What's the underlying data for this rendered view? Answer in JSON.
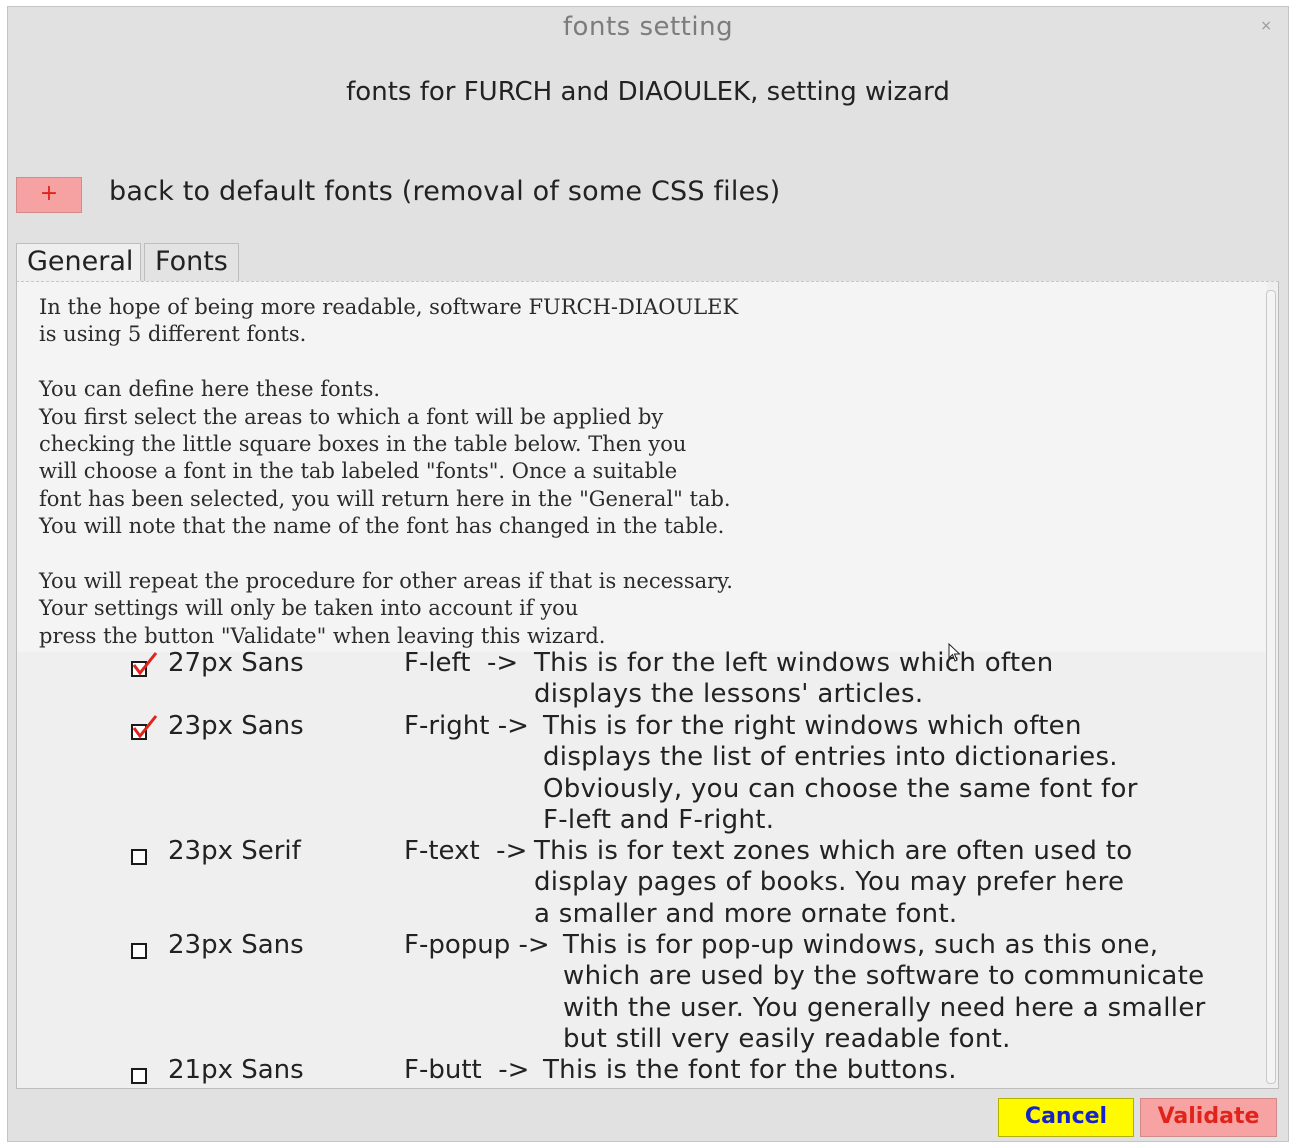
{
  "window": {
    "title": "fonts setting",
    "close_glyph": "×",
    "subtitle": "fonts for FURCH and DIAOULEK, setting wizard"
  },
  "reset": {
    "button_label": "+",
    "label": "back to default fonts (removal of some CSS files)"
  },
  "tabs": [
    {
      "label": "General",
      "active": true
    },
    {
      "label": "Fonts",
      "active": false
    }
  ],
  "intro_text": "In the hope of being more readable, software FURCH-DIAOULEK\nis using 5 different fonts.\n\nYou can define here these fonts.\nYou first select the areas to which a font will be applied by\nchecking the little square boxes in the table below. Then you\nwill choose a font in the tab labeled \"fonts\". Once a suitable\nfont has been selected, you will return here in the \"General\" tab.\nYou will note that the name of the font has changed in the table.\n\nYou will repeat the procedure for other areas if that is necessary.\nYour settings will only be taken into account if you\npress the button \"Validate\" when leaving this wizard.",
  "font_rows": [
    {
      "checked": true,
      "font": "27px Sans",
      "code": "F-left  ->",
      "description": "This is for the left windows which often\ndisplays the lessons' articles."
    },
    {
      "checked": true,
      "font": "23px Sans",
      "code": "F-right ->",
      "description": "This is for the right windows which often\ndisplays the list of entries into dictionaries.\nObviously, you can choose the same font for\nF-left and F-right."
    },
    {
      "checked": false,
      "font": "23px Serif",
      "code": "F-text  ->",
      "description": "This is for text zones which are often used to\ndisplay pages of books. You may prefer here\na smaller and more ornate font."
    },
    {
      "checked": false,
      "font": "23px Sans",
      "code": "F-popup ->",
      "description": "This is for pop-up windows, such as this one,\nwhich are used by the software to communicate\nwith the user. You generally need here a smaller\nbut still very easily readable font."
    },
    {
      "checked": false,
      "font": "21px Sans",
      "code": "F-butt  ->",
      "description": "This is the font for the buttons."
    }
  ],
  "buttons": {
    "cancel": "Cancel",
    "validate": "Validate"
  },
  "colors": {
    "check_red": "#e0241c",
    "cancel_bg": "#fffa00",
    "cancel_text": "#1523c9",
    "validate_bg": "#f7a3a3",
    "validate_text": "#e0241c"
  }
}
